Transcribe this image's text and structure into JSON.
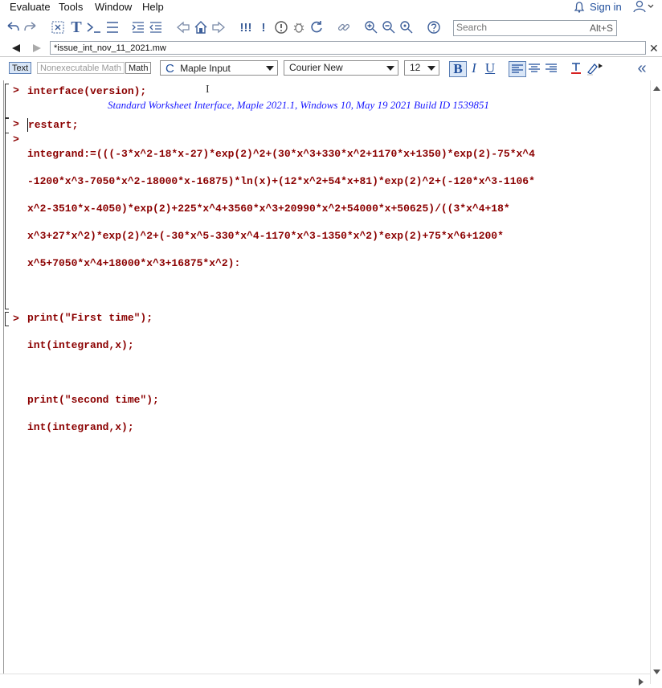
{
  "menu": [
    "Evaluate",
    "Tools",
    "Window",
    "Help"
  ],
  "account": {
    "sign_in": "Sign in"
  },
  "search": {
    "placeholder": "Search",
    "shortcut": "Alt+S"
  },
  "document": {
    "tab_title": "*issue_int_nov_11_2021.mw"
  },
  "format": {
    "text_mode": "Text",
    "nonexec_mode": "Nonexecutable Math",
    "math_mode": "Math",
    "style": "Maple Input",
    "font": "Courier New",
    "size": "12"
  },
  "worksheet": {
    "prompt": ">",
    "cmd1": "interface(version);",
    "output1": "Standard Worksheet Interface, Maple 2021.1, Windows 10, May 19 2021 Build ID 1539851",
    "cmd2": "restart;",
    "cmd3_lines": [
      "integrand:=(((-3*x^2-18*x-27)*exp(2)^2+(30*x^3+330*x^2+1170*x+1350)*exp(2)-75*x^4",
      "-1200*x^3-7050*x^2-18000*x-16875)*ln(x)+(12*x^2+54*x+81)*exp(2)^2+(-120*x^3-1106*",
      "x^2-3510*x-4050)*exp(2)+225*x^4+3560*x^3+20990*x^2+54000*x+50625)/((3*x^4+18*",
      "x^3+27*x^2)*exp(2)^2+(-30*x^5-330*x^4-1170*x^3-1350*x^2)*exp(2)+75*x^6+1200*",
      "x^5+7050*x^4+18000*x^3+16875*x^2):",
      "",
      "print(\"First time\");",
      "int(integrand,x);",
      "",
      "print(\"second time\");",
      "int(integrand,x);"
    ]
  }
}
